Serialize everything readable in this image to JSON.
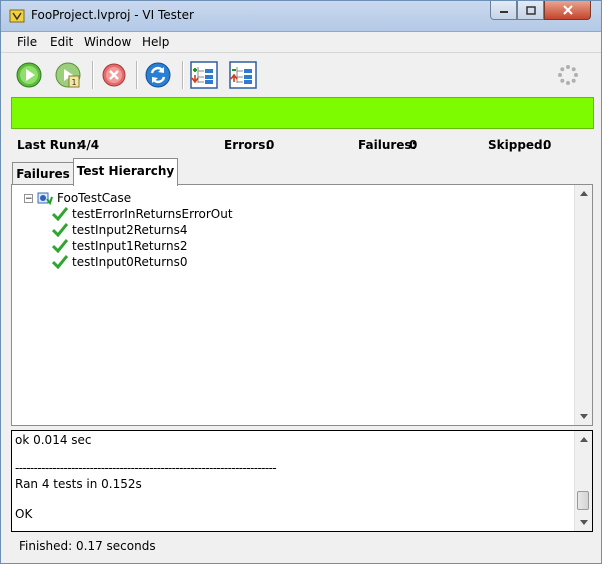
{
  "window": {
    "title": "FooProject.lvproj - VI Tester"
  },
  "menu": [
    "File",
    "Edit",
    "Window",
    "Help"
  ],
  "toolbar": {
    "icons": [
      "run-icon",
      "run-single-icon",
      "abort-icon",
      "refresh-icon",
      "expand-tree-icon",
      "collapse-tree-icon",
      "busy-spinner-icon"
    ]
  },
  "progress": {
    "color": "#7dfc00",
    "fraction": 1.0
  },
  "stats": {
    "last_run_label": "Last Run:",
    "last_run_value": "4/4",
    "errors_label": "Errors:",
    "errors_value": "0",
    "failures_label": "Failures:",
    "failures_value": "0",
    "skipped_label": "Skipped:",
    "skipped_value": "0"
  },
  "tabs": {
    "failures": "Failures",
    "hierarchy": "Test Hierarchy",
    "active": "Test Hierarchy"
  },
  "tree": {
    "root": "FooTestCase",
    "expander": "−",
    "items": [
      "testErrorInReturnsErrorOut",
      "testInput2Returns4",
      "testInput1Returns2",
      "testInput0Returns0"
    ]
  },
  "log": {
    "lines": [
      "ok 0.014 sec",
      "",
      "----------------------------------------------------------------------",
      "Ran 4 tests in 0.152s",
      "",
      "OK"
    ]
  },
  "status": {
    "text": "Finished: 0.17 seconds"
  }
}
